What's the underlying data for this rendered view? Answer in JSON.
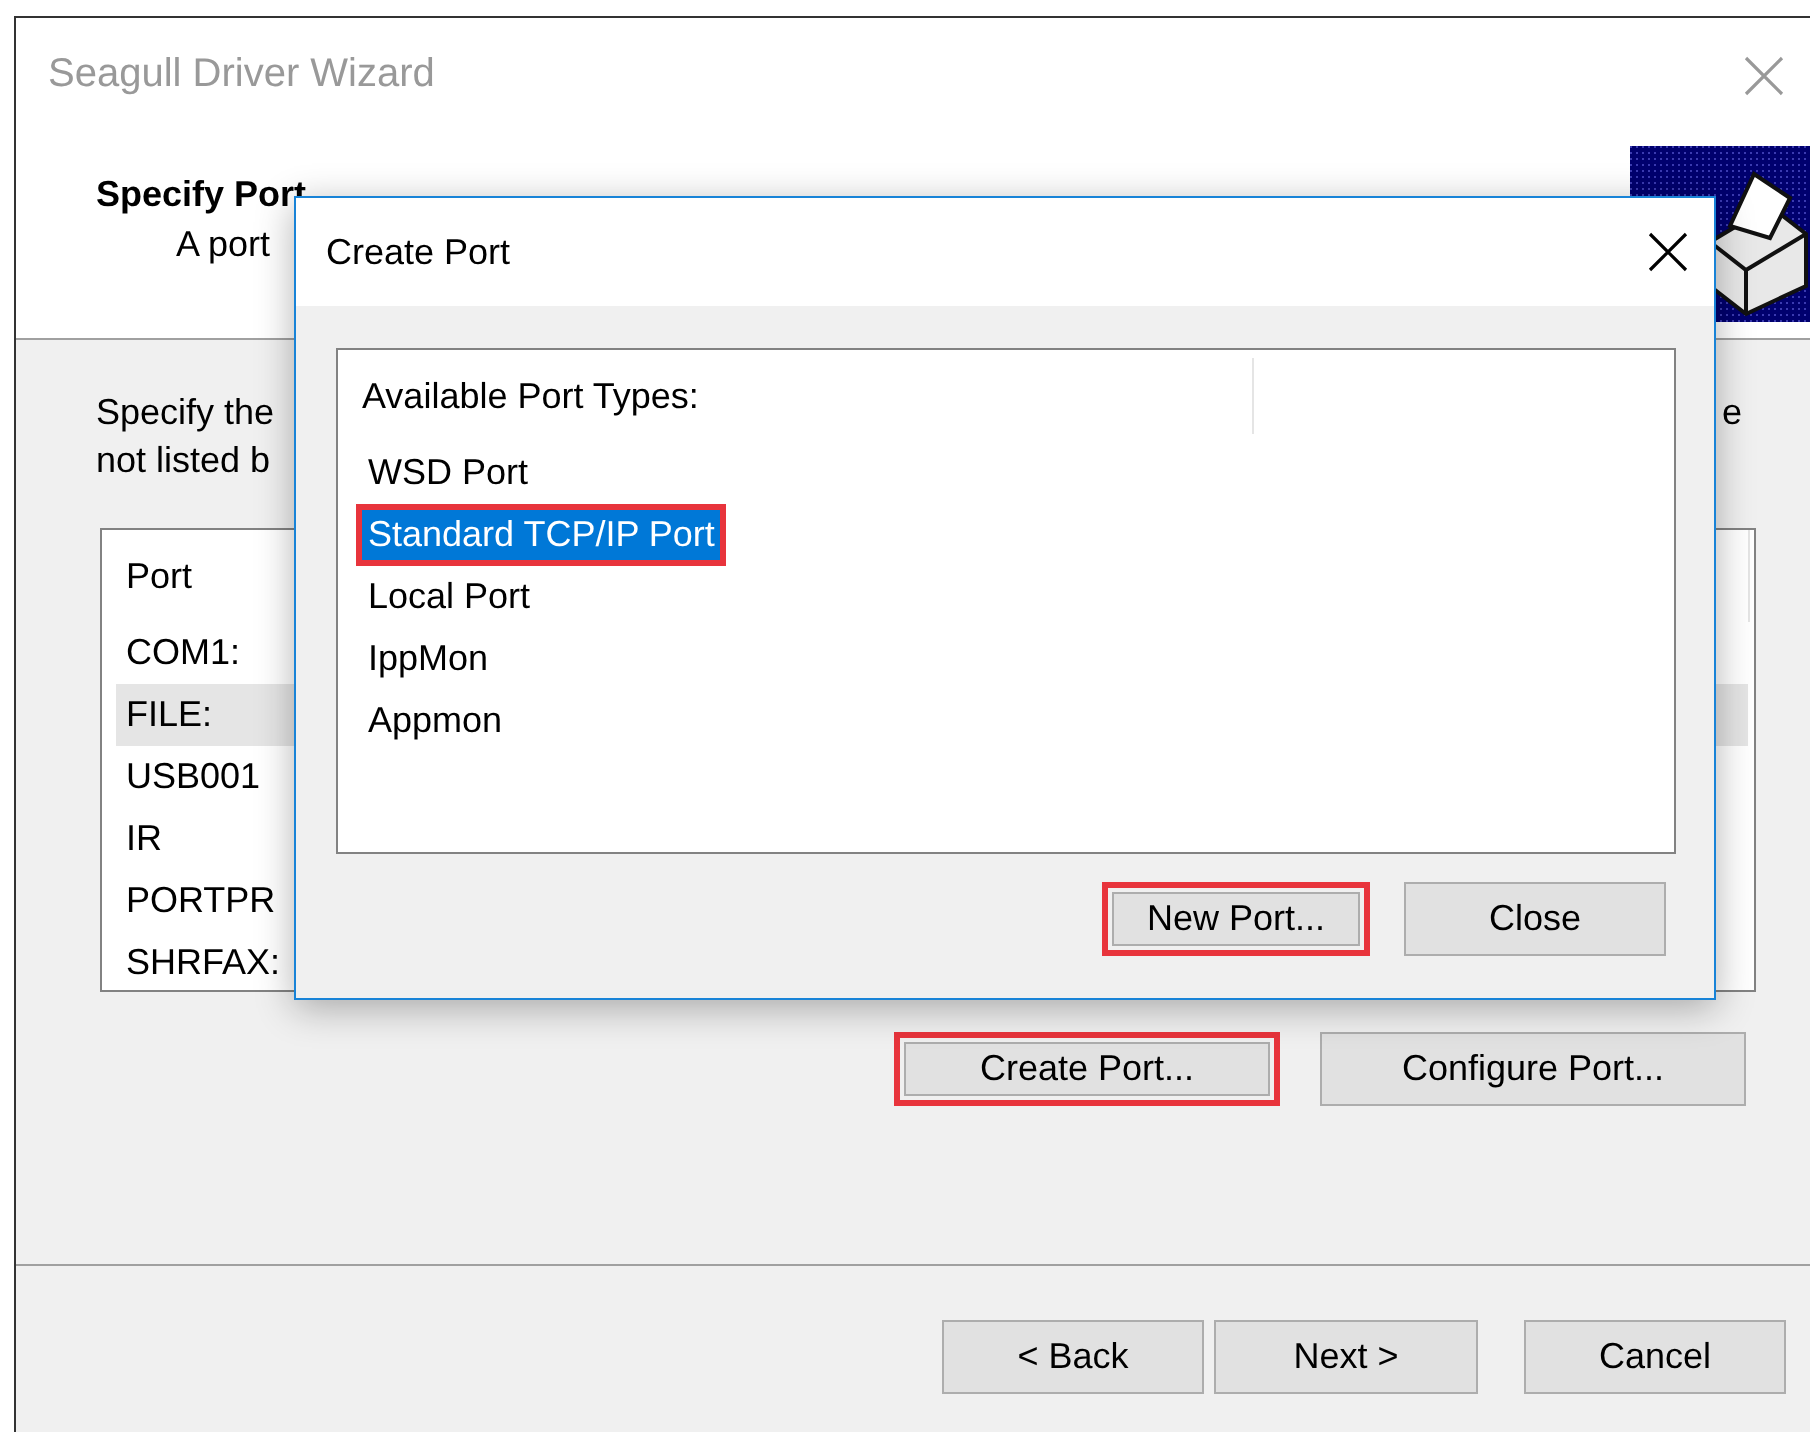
{
  "window": {
    "title": "Seagull Driver Wizard"
  },
  "header": {
    "title": "Specify Port",
    "subtitle": "A port"
  },
  "intro": {
    "lines": [
      "Specify the",
      "not listed b"
    ],
    "tail": "e"
  },
  "port_list": {
    "column": "Port",
    "rows": [
      {
        "name": "COM1:",
        "selected": false
      },
      {
        "name": "FILE:",
        "selected": true
      },
      {
        "name": "USB001",
        "selected": false
      },
      {
        "name": "IR",
        "selected": false
      },
      {
        "name": "PORTPR",
        "selected": false
      },
      {
        "name": "SHRFAX:",
        "selected": false
      }
    ]
  },
  "port_buttons": [
    {
      "label": "Create Port...",
      "highlighted": true
    },
    {
      "label": "Configure Port...",
      "highlighted": false
    }
  ],
  "nav_buttons": [
    {
      "label": "< Back"
    },
    {
      "label": "Next >"
    },
    {
      "label": "Cancel"
    }
  ],
  "dialog": {
    "title": "Create Port",
    "list_header": "Available Port Types:",
    "port_types": [
      {
        "name": "WSD Port",
        "selected": false,
        "highlighted": false
      },
      {
        "name": "Standard TCP/IP Port",
        "selected": true,
        "highlighted": true
      },
      {
        "name": "Local Port",
        "selected": false,
        "highlighted": false
      },
      {
        "name": "IppMon",
        "selected": false,
        "highlighted": false
      },
      {
        "name": "Appmon",
        "selected": false,
        "highlighted": false
      }
    ],
    "buttons": [
      {
        "label": "New Port...",
        "highlighted": true
      },
      {
        "label": "Close",
        "highlighted": false
      }
    ]
  }
}
